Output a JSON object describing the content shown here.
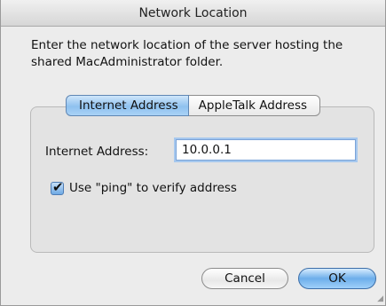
{
  "window": {
    "title": "Network Location"
  },
  "message": "Enter the network location of the server hosting the shared MacAdministrator folder.",
  "tabs": [
    {
      "label": "Internet Address",
      "selected": true
    },
    {
      "label": "AppleTalk Address",
      "selected": false
    }
  ],
  "form": {
    "address_label": "Internet Address:",
    "address_value": "10.0.0.1",
    "ping_label": "Use \"ping\" to verify address",
    "ping_checked": true
  },
  "buttons": {
    "cancel_label": "Cancel",
    "ok_label": "OK"
  },
  "colors": {
    "accent": "#6daeea",
    "window_background": "#ececec"
  },
  "icons": {
    "checkmark": "checkmark-icon",
    "resize": "resize-grip-icon"
  }
}
